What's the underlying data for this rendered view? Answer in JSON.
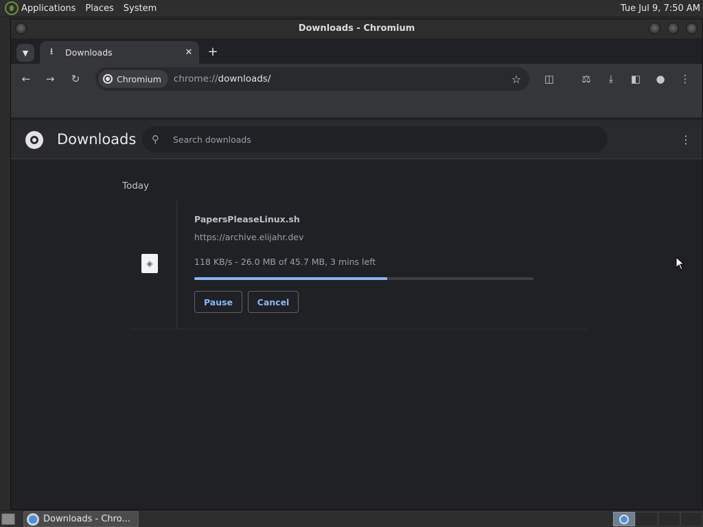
{
  "top_panel": {
    "menus": [
      "Applications",
      "Places",
      "System"
    ],
    "clock": "Tue Jul  9,  7:50 AM"
  },
  "window": {
    "title": "Downloads - Chromium"
  },
  "tabs": {
    "active_label": "Downloads",
    "close_glyph": "✕",
    "new_tab_glyph": "+"
  },
  "toolbar": {
    "chip_label": "Chromium",
    "url_scheme": "chrome://",
    "url_host": "downloads/"
  },
  "downloads_page": {
    "title": "Downloads",
    "search_placeholder": "Search downloads",
    "date_group": "Today",
    "item": {
      "file_name": "PapersPleaseLinux.sh",
      "source_url": "https://archive.elijahr.dev",
      "status": "118 KB/s - 26.0 MB of 45.7 MB, 3 mins left",
      "progress_fraction": 0.569,
      "pause_label": "Pause",
      "cancel_label": "Cancel"
    }
  },
  "taskbar": {
    "task_label": "Downloads - Chro..."
  },
  "colors": {
    "accent": "#8ab4f8",
    "page_bg": "#202124",
    "toolbar_bg": "#35363a"
  }
}
